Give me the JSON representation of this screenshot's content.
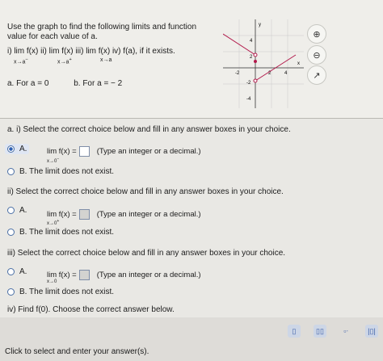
{
  "header": {
    "prompt": "Use the graph to find the following limits and function value for each value of a.",
    "limits_line": "i)  lim  f(x)  ii)  lim  f(x)  iii)  lim  f(x)  iv)  f(a), if it exists.",
    "limits_sub_1": "x→a",
    "limits_sup_1": "−",
    "limits_sub_2": "x→a",
    "limits_sup_2": "+",
    "limits_sub_3": "x→a",
    "part_a": "a.  For a = 0",
    "part_b": "b.  For a = − 2"
  },
  "graph_labels": {
    "y": "y",
    "x": "x",
    "y4": "4",
    "y2": "2",
    "x_neg2": "-2",
    "x2": "2",
    "x4": "4",
    "y_neg2": "-2",
    "y_neg4": "-4"
  },
  "tools": {
    "zoom_in": "⊕",
    "zoom_out": "⊖",
    "popout": "↗"
  },
  "q1": {
    "prompt": "a. i) Select the correct choice below and fill in any answer boxes in your choice.",
    "a_label": "A.",
    "lim": "lim  f(x) =",
    "sub": "x→0",
    "sup": "−",
    "hint": "(Type an integer or a decimal.)",
    "b_label": "B.  The limit does not exist."
  },
  "q2": {
    "prompt": "ii) Select the correct choice below and fill in any answer boxes in your choice.",
    "a_label": "A.",
    "lim": "lim  f(x) =",
    "sub": "x→0",
    "sup": "+",
    "hint": "(Type an integer or a decimal.)",
    "b_label": "B.  The limit does not exist."
  },
  "q3": {
    "prompt": "iii) Select the correct choice below and fill in any answer boxes in your choice.",
    "a_label": "A.",
    "lim": "lim  f(x) =",
    "sub": "x→0",
    "hint": "(Type an integer or a decimal.)",
    "b_label": "B.  The limit does not exist."
  },
  "q4": {
    "prompt": "iv) Find f(0). Choose the correct answer below."
  },
  "status": "Click to select and enter your answer(s)."
}
